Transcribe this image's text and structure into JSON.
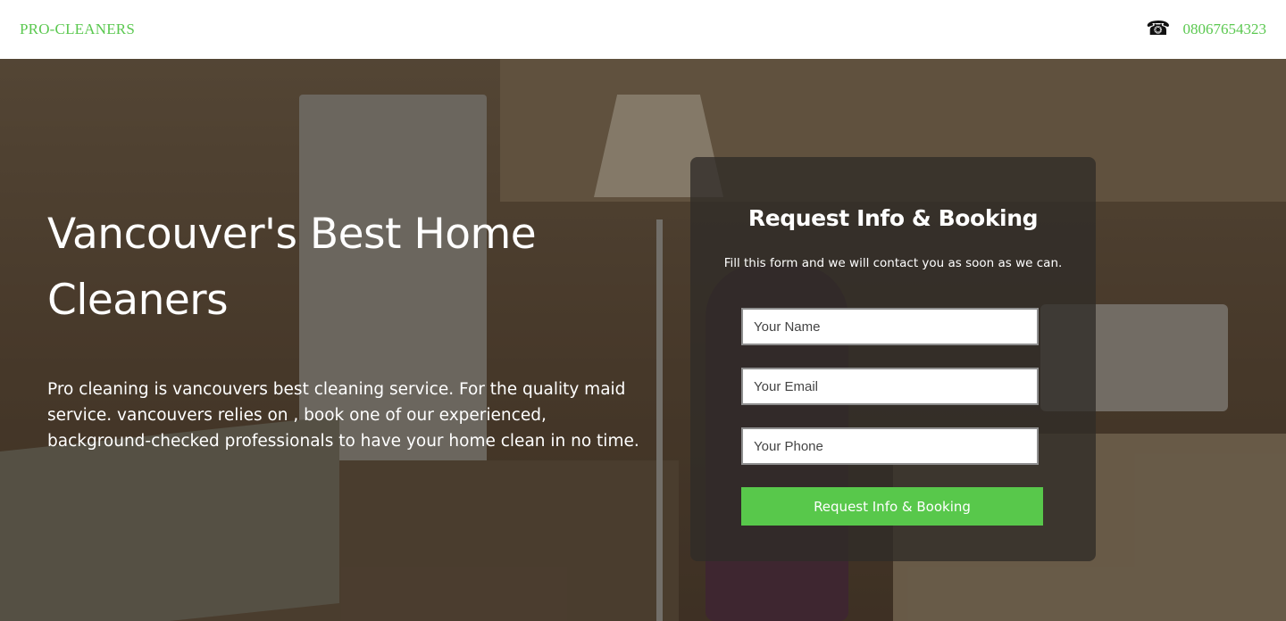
{
  "header": {
    "brand": "PRO-CLEANERS",
    "phone_icon": "telephone-icon",
    "phone_number": "08067654323"
  },
  "hero": {
    "headline": "Vancouver's Best Home Cleaners",
    "description": "Pro cleaning is vancouvers best cleaning service. For the quality maid service. vancouvers relies on , book one of our experienced, background-checked professionals to have your home clean in no time."
  },
  "form": {
    "title": "Request Info & Booking",
    "description": "Fill this form and we will contact you as soon as we can.",
    "name_placeholder": "Your Name",
    "email_placeholder": "Your Email",
    "phone_placeholder": "Your Phone",
    "submit_label": "Request Info & Booking"
  },
  "colors": {
    "accent": "#58c84b",
    "brand_text": "#5ac84f"
  }
}
